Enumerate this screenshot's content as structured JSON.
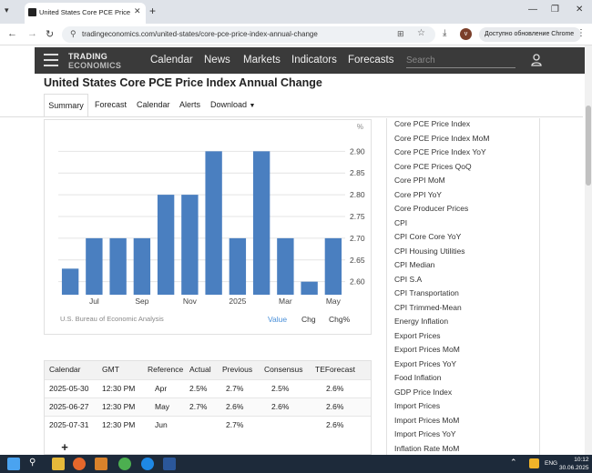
{
  "browser": {
    "tab_title": "United States Core PCE Price Index",
    "url": "tradingeconomics.com/united-states/core-pce-price-index-annual-change",
    "update_button": "Доступно обновление Chrome",
    "avatar_letter": "v"
  },
  "site": {
    "logo_line1": "TRADING",
    "logo_line2": "ECONOMICS",
    "nav": [
      "Calendar",
      "News",
      "Markets",
      "Indicators",
      "Forecasts"
    ],
    "search_placeholder": "Search"
  },
  "page": {
    "title": "United States Core PCE Price Index Annual Change",
    "subtabs": [
      "Summary",
      "Forecast",
      "Calendar",
      "Alerts",
      "Download"
    ]
  },
  "chart_data": {
    "type": "bar",
    "unit_label": "%",
    "source": "U.S. Bureau of Economic Analysis",
    "categories": [
      "2024-06",
      "2024-07",
      "2024-08",
      "2024-09",
      "2024-10",
      "2024-11",
      "2024-12",
      "2025-01",
      "2025-02",
      "2025-03",
      "2025-04",
      "2025-05"
    ],
    "values": [
      2.63,
      2.7,
      2.7,
      2.7,
      2.8,
      2.8,
      2.9,
      2.7,
      2.9,
      2.7,
      2.6,
      2.7
    ],
    "x_tick_labels": [
      "Jul",
      "Sep",
      "Nov",
      "2025",
      "Mar",
      "May"
    ],
    "y_ticks": [
      2.6,
      2.65,
      2.7,
      2.75,
      2.8,
      2.85,
      2.9
    ],
    "y_tick_labels": [
      "2.60",
      "2.65",
      "2.70",
      "2.75",
      "2.80",
      "2.85",
      "2.90"
    ],
    "ylim": [
      2.57,
      2.93
    ],
    "bar_color": "#4a7fc0",
    "grid": true,
    "view_tabs": [
      "Value",
      "Chg",
      "Chg%"
    ],
    "active_view_color": "#4a90d9"
  },
  "table": {
    "headers": [
      "Calendar",
      "GMT",
      "Reference",
      "Actual",
      "Previous",
      "Consensus",
      "TEForecast"
    ],
    "rows": [
      [
        "2025-05-30",
        "12:30 PM",
        "Apr",
        "2.5%",
        "2.7%",
        "2.5%",
        "2.6%"
      ],
      [
        "2025-06-27",
        "12:30 PM",
        "May",
        "2.7%",
        "2.6%",
        "2.6%",
        "2.6%"
      ],
      [
        "2025-07-31",
        "12:30 PM",
        "Jun",
        "",
        "2.7%",
        "",
        "2.6%"
      ]
    ],
    "add_label": "+"
  },
  "sidebar": {
    "items": [
      "Core PCE Price Index",
      "Core PCE Price Index MoM",
      "Core PCE Price Index YoY",
      "Core PCE Prices QoQ",
      "Core PPI MoM",
      "Core PPI YoY",
      "Core Producer Prices",
      "CPI",
      "CPI Core Core YoY",
      "CPI Housing Utilities",
      "CPI Median",
      "CPI S.A",
      "CPI Transportation",
      "CPI Trimmed-Mean",
      "Energy Inflation",
      "Export Prices",
      "Export Prices MoM",
      "Export Prices YoY",
      "Food Inflation",
      "GDP Price Index",
      "Import Prices",
      "Import Prices MoM",
      "Import Prices YoY",
      "Inflation Rate MoM"
    ]
  },
  "taskbar": {
    "lang": "ENG",
    "time": "10:12",
    "date": "30.06.2025"
  }
}
